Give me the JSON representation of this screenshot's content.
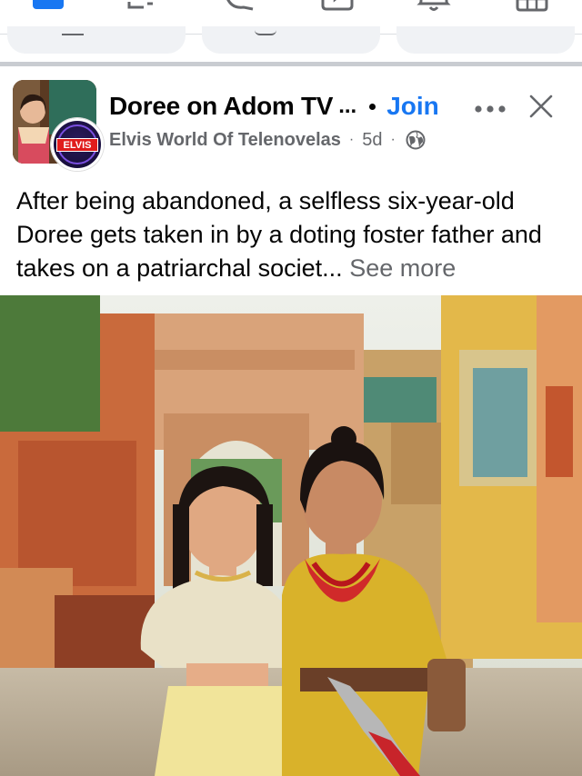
{
  "nav": {
    "icons": [
      "home-icon",
      "friends-icon",
      "messenger-icon",
      "video-icon",
      "notifications-icon",
      "marketplace-icon"
    ],
    "active_color": "#1877f2"
  },
  "post": {
    "group_name": "Doree on Adom TV",
    "name_ellipsis": "...",
    "join_label": "Join",
    "badge_text": "ELVIS",
    "author": "Elvis World Of Telenovelas",
    "timestamp": "5d",
    "audience_icon": "globe-icon",
    "body_text": "After being abandoned, a selfless six-year-old Doree gets taken in by a doting foster father and takes on a patriarchal societ...",
    "see_more_label": "See more"
  },
  "colors": {
    "link": "#1877f2",
    "meta": "#65676b",
    "text": "#050505",
    "divider": "#c9ccd1"
  }
}
